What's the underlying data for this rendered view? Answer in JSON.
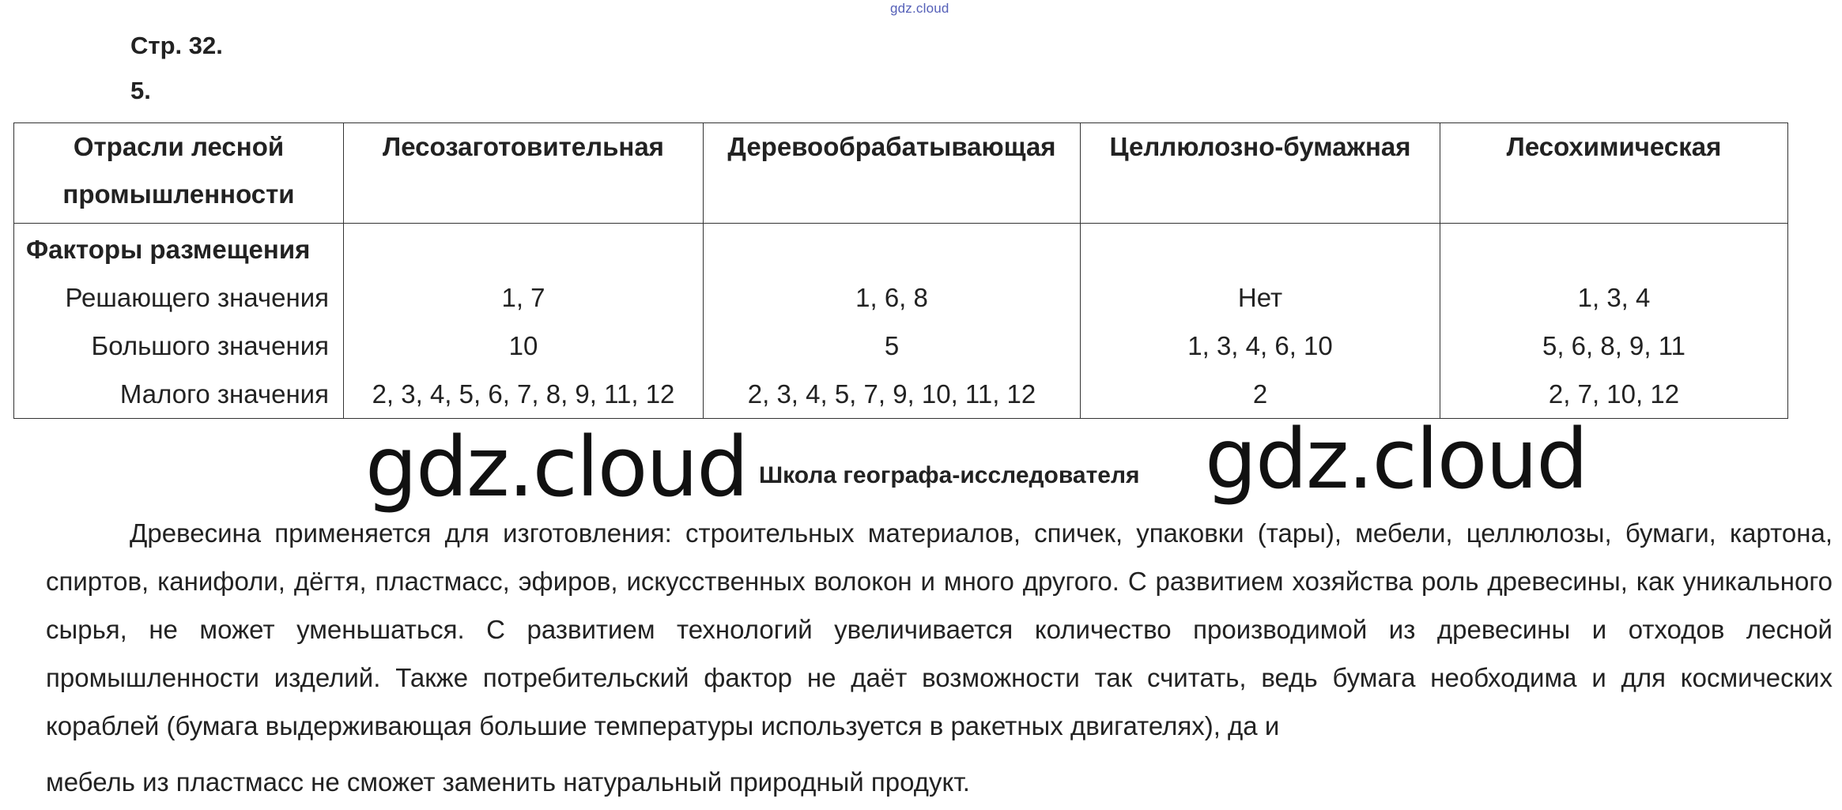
{
  "watermark_small": "gdz.cloud",
  "watermark_big": "gdz.cloud",
  "page_label": "Стр. 32.",
  "task_label": "5.",
  "table": {
    "header_corner_line1": "Отрасли лесной",
    "header_corner_line2": "промышленности",
    "columns": [
      "Лесозаготовительная",
      "Деревообрабатывающая",
      "Целлюлозно-бумажная",
      "Лесохимическая"
    ],
    "factors_title": "Факторы размещения",
    "row_labels": [
      "Решающего значения",
      "Большого значения",
      "Малого значения"
    ],
    "values": [
      [
        "1, 7",
        "10",
        "2, 3, 4, 5, 6, 7, 8, 9, 11, 12"
      ],
      [
        "1, 6, 8",
        "5",
        "2, 3, 4, 5, 7, 9, 10, 11, 12"
      ],
      [
        "Нет",
        "1, 3, 4, 6, 10",
        "2"
      ],
      [
        "1, 3, 4",
        "5, 6, 8, 9, 11",
        "2, 7, 10, 12"
      ]
    ]
  },
  "section_title": "Школа географа-исследователя",
  "paragraph": "Древесина применяется для изготовления: строительных материалов, спичек, упаковки (тары), мебели, целлюлозы, бумаги, картона, спиртов, канифоли, дёгтя, пластмасс, эфиров, искусственных волокон и много другого. С развитием хозяйства роль древесины, как уникального сырья, не может уменьшаться. С развитием технологий увеличивается количество производимой из древесины и отходов лесной промышленности изделий. Также потребительский фактор не даёт возможности так считать, ведь бумага необходима и для космических кораблей (бумага выдерживающая большие температуры используется в ракетных двигателях), да и",
  "paragraph_last_line": "мебель из пластмасс не сможет заменить натуральный природный продукт."
}
